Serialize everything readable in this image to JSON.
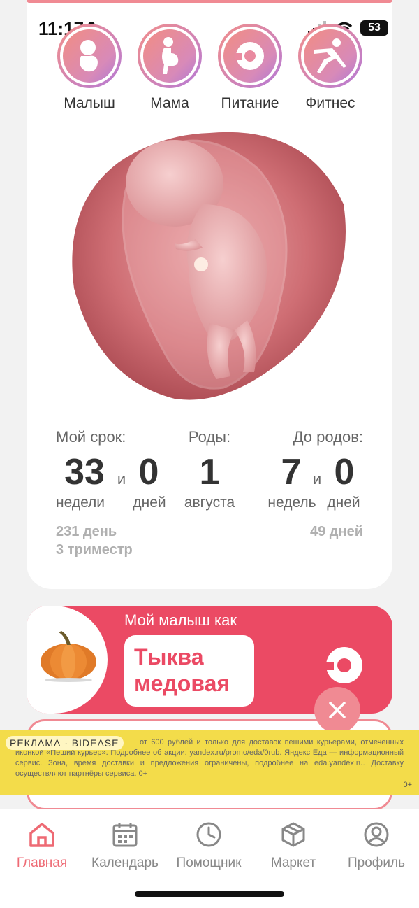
{
  "status": {
    "time": "11:17",
    "battery": "53"
  },
  "categories": [
    {
      "label": "Малыш",
      "icon": "baby-icon"
    },
    {
      "label": "Мама",
      "icon": "pregnant-woman-icon"
    },
    {
      "label": "Питание",
      "icon": "donut-icon"
    },
    {
      "label": "Фитнес",
      "icon": "fitness-icon"
    }
  ],
  "stats": {
    "term_label": "Мой срок:",
    "term_weeks": "33",
    "term_and": "и",
    "term_days": "0",
    "term_weeks_unit": "недели",
    "term_days_unit": "дней",
    "term_total_days": "231 день",
    "trimester": "3 триместр",
    "birth_label": "Роды:",
    "birth_day": "1",
    "birth_month": "августа",
    "left_label": "До родов:",
    "left_weeks": "7",
    "left_and": "и",
    "left_days": "0",
    "left_weeks_unit": "недель",
    "left_days_unit": "дней",
    "left_total_days": "49 дней"
  },
  "baby_card": {
    "title": "Мой малыш как",
    "fruit_line1": "Тыква",
    "fruit_line2": "медовая"
  },
  "ad": {
    "label": "РЕКЛАМА · BIDEASE",
    "text": "от 600 рублей и только для доставок пешими курьерами, отмеченных иконкой «Пеший курьер». Подробнее об акции: yandex.ru/promo/eda/0rub. Яндекс Еда — информационный сервис. Зона, время доставки и предложения ограничены, подробнее на eda.yandex.ru. Доставку осуществляют партнёры сервиса. 0+",
    "age": "0+"
  },
  "tabs": [
    {
      "label": "Главная",
      "icon": "home-icon",
      "active": true
    },
    {
      "label": "Календарь",
      "icon": "calendar-icon",
      "active": false
    },
    {
      "label": "Помощник",
      "icon": "clock-icon",
      "active": false
    },
    {
      "label": "Маркет",
      "icon": "box-icon",
      "active": false
    },
    {
      "label": "Профиль",
      "icon": "profile-icon",
      "active": false
    }
  ],
  "colors": {
    "accent": "#eb4a64",
    "accent_light": "#f08a93",
    "ad_bg": "#f3dc4a"
  }
}
